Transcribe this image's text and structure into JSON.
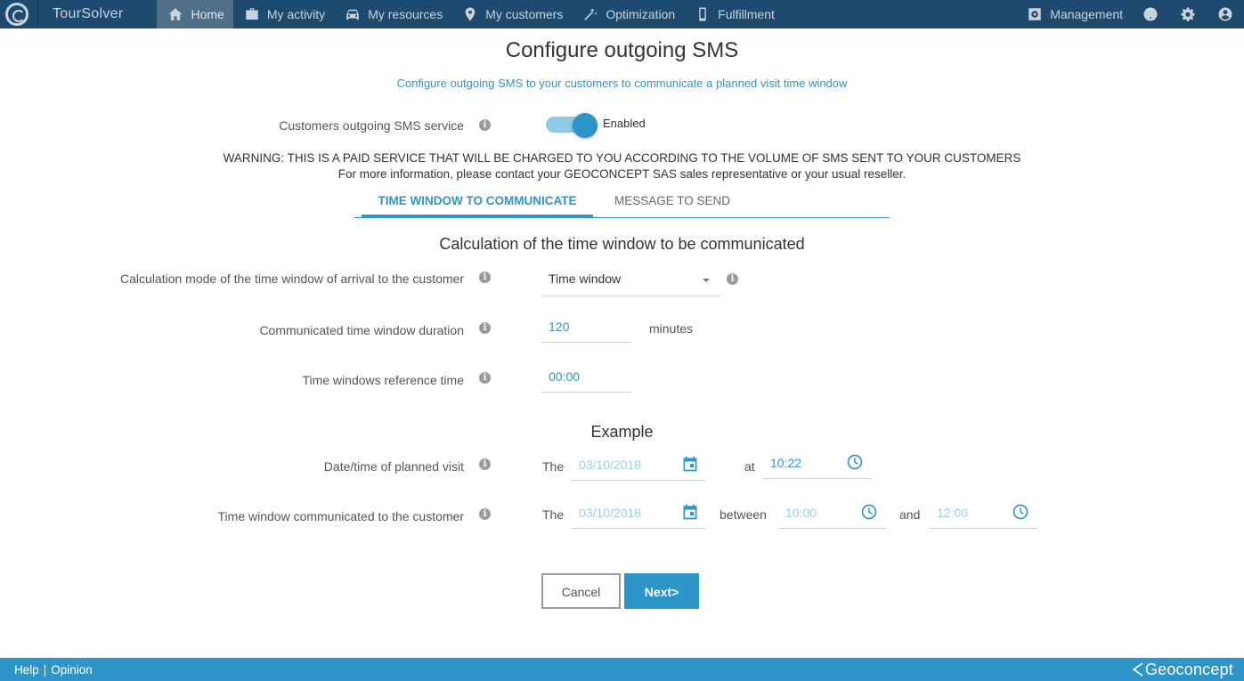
{
  "app": {
    "name": "TourSolver"
  },
  "nav": {
    "items": [
      {
        "label": "Home",
        "icon": "home-icon",
        "active": true
      },
      {
        "label": "My activity",
        "icon": "briefcase-icon"
      },
      {
        "label": "My resources",
        "icon": "car-icon"
      },
      {
        "label": "My customers",
        "icon": "location-pin-icon"
      },
      {
        "label": "Optimization",
        "icon": "magic-wand-icon"
      },
      {
        "label": "Fulfillment",
        "icon": "phone-icon"
      }
    ],
    "management_label": "Management"
  },
  "page": {
    "title": "Configure outgoing SMS",
    "subtitle": "Configure outgoing SMS to your customers to communicate a planned visit time window"
  },
  "service": {
    "label": "Customers outgoing SMS service",
    "toggle_label": "Enabled",
    "enabled": true
  },
  "warning": {
    "line1": "WARNING: THIS IS A PAID SERVICE THAT WILL BE CHARGED TO YOU ACCORDING TO THE VOLUME OF SMS SENT TO YOUR CUSTOMERS",
    "line2": "For more information, please contact your GEOCONCEPT SAS sales representative or your usual reseller."
  },
  "tabs": [
    {
      "label": "TIME WINDOW TO COMMUNICATE",
      "active": true
    },
    {
      "label": "MESSAGE TO SEND",
      "active": false
    }
  ],
  "calculation": {
    "section_title": "Calculation of the time window to be communicated",
    "mode_label": "Calculation mode of the time window of arrival to the customer",
    "mode_value": "Time window",
    "duration_label": "Communicated time window duration",
    "duration_value": "120",
    "duration_unit": "minutes",
    "reference_label": "Time windows reference time",
    "reference_value": "00:00"
  },
  "example": {
    "section_title": "Example",
    "planned_label": "Date/time of planned visit",
    "the": "The",
    "at": "at",
    "between": "between",
    "and": "and",
    "planned_date": "03/10/2018",
    "planned_time": "10:22",
    "communicated_label": "Time window communicated to the customer",
    "communicated_date": "03/10/2018",
    "window_start": "10:00",
    "window_end": "12:00"
  },
  "buttons": {
    "cancel": "Cancel",
    "next": "Next>"
  },
  "footer": {
    "help": "Help",
    "separator": "|",
    "opinion": "Opinion",
    "brand": "Geoconcept"
  },
  "colors": {
    "nav_bg": "#1d4a6e",
    "accent": "#2d95c9",
    "footer_bg": "#2d95c9"
  }
}
